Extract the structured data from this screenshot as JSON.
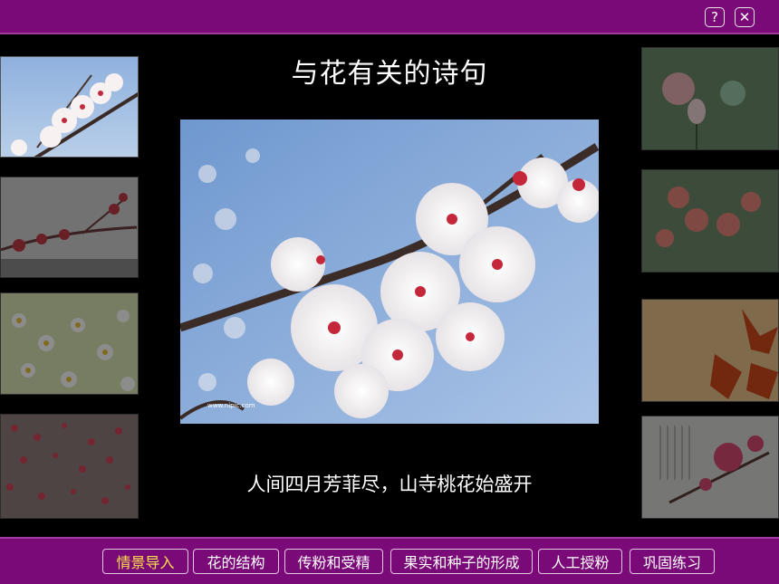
{
  "toolbar": {
    "help_label": "?",
    "close_label": "✕"
  },
  "main": {
    "title": "与花有关的诗句",
    "caption": "人间四月芳菲尽，山寺桃花始盛开",
    "watermark": "www.nipic.com"
  },
  "nav": {
    "items": [
      "情景导入",
      "花的结构",
      "传粉和受精",
      "果实和种子的形成",
      "人工授粉",
      "巩固练习"
    ],
    "active_index": 0
  },
  "colors": {
    "bar_purple": "#7a0a78",
    "active_text": "#ffe14a",
    "sky_blue": "#7ea5d6"
  }
}
